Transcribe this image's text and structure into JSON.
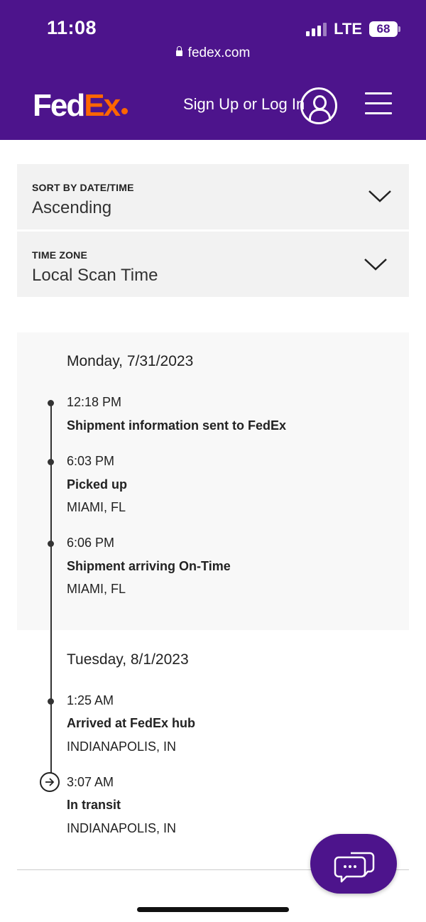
{
  "status_bar": {
    "time": "11:08",
    "network": "LTE",
    "battery": "68"
  },
  "browser": {
    "url": "fedex.com"
  },
  "header": {
    "logo_fed": "Fed",
    "logo_ex": "Ex",
    "signin_label": "Sign Up or Log In",
    "brand_color": "#4d148c",
    "accent_color": "#ff6600"
  },
  "sort": {
    "label": "SORT BY DATE/TIME",
    "value": "Ascending"
  },
  "timezone": {
    "label": "TIME ZONE",
    "value": "Local Scan Time"
  },
  "days": [
    {
      "date": "Monday, 7/31/2023",
      "events": [
        {
          "time": "12:18 PM",
          "status": "Shipment information sent to FedEx",
          "location": ""
        },
        {
          "time": "6:03 PM",
          "status": "Picked up",
          "location": "MIAMI, FL"
        },
        {
          "time": "6:06 PM",
          "status": "Shipment arriving On-Time",
          "location": "MIAMI, FL"
        }
      ]
    },
    {
      "date": "Tuesday, 8/1/2023",
      "events": [
        {
          "time": "1:25 AM",
          "status": "Arrived at FedEx hub",
          "location": "INDIANAPOLIS, IN"
        },
        {
          "time": "3:07 AM",
          "status": "In transit",
          "location": "INDIANAPOLIS, IN"
        }
      ]
    }
  ],
  "icons": {
    "lock": "lock-icon",
    "account": "account-icon",
    "menu": "hamburger-menu-icon",
    "chevron": "chevron-down-icon",
    "transit": "arrow-right-circle-icon",
    "chat": "chat-icon"
  }
}
